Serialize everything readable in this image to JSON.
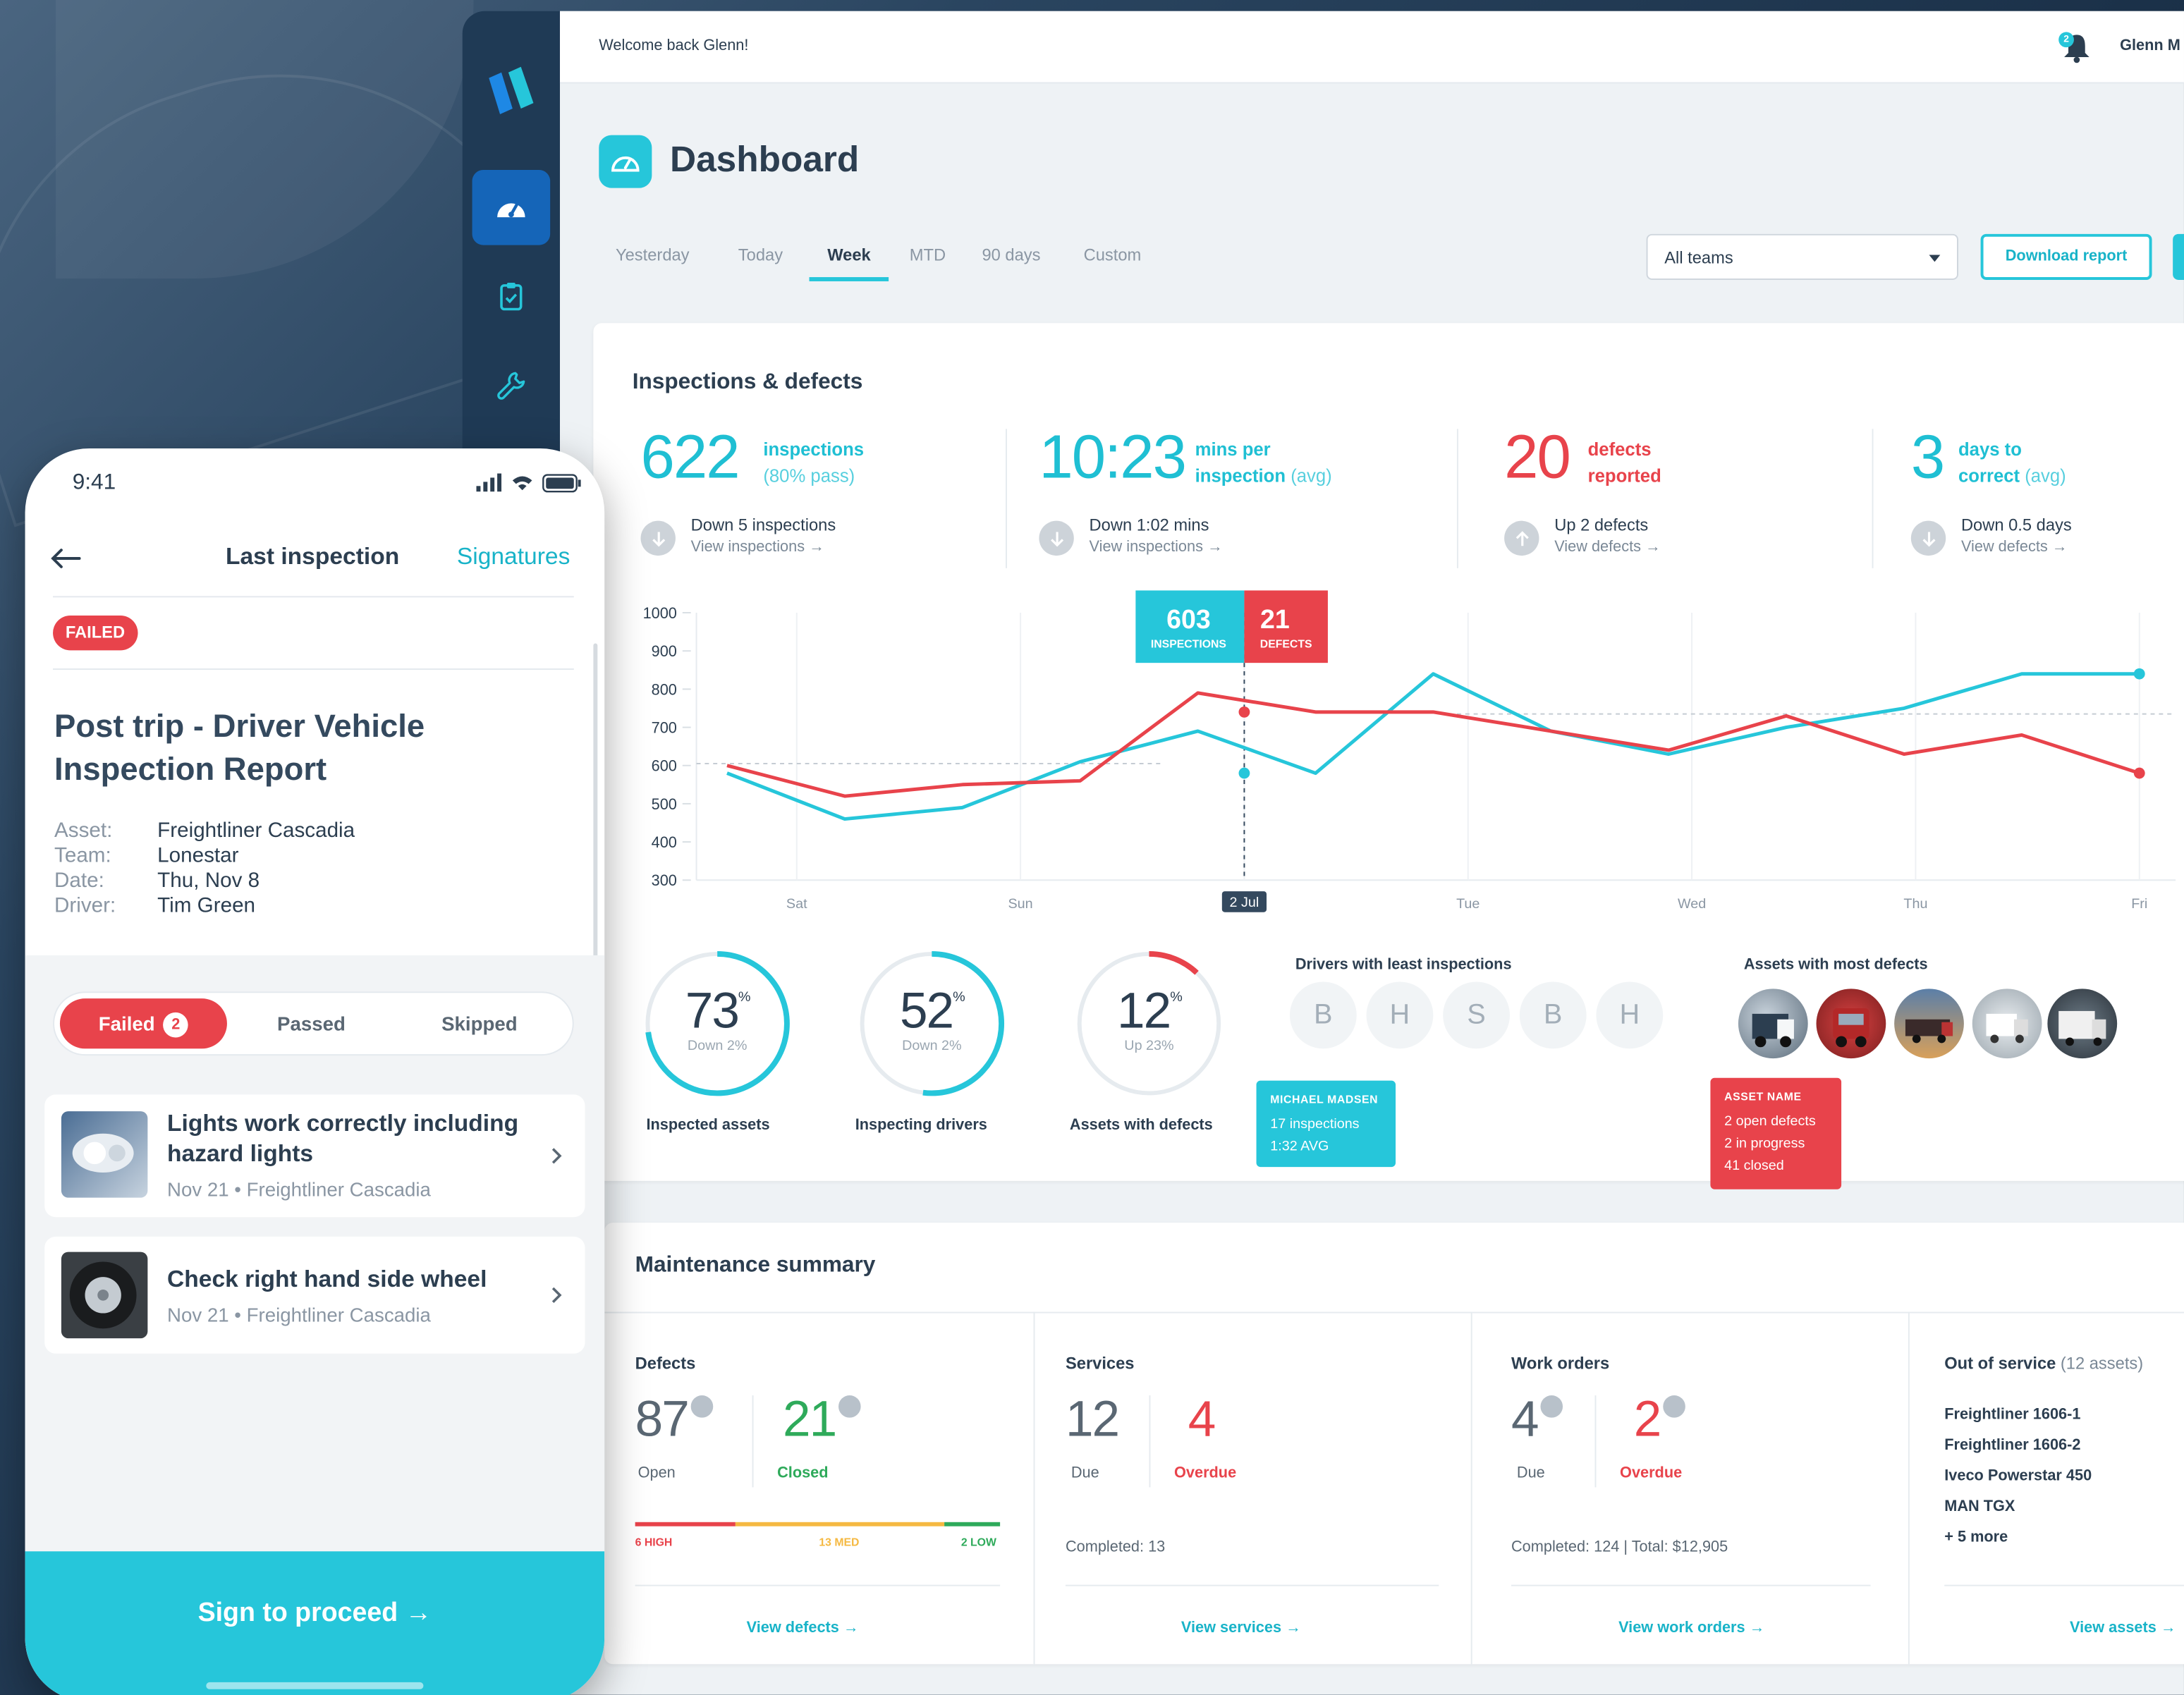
{
  "topbar": {
    "welcome": "Welcome back Glenn!",
    "notif_count": "2",
    "user": "Glenn M"
  },
  "page": {
    "title": "Dashboard"
  },
  "tabs": [
    "Yesterday",
    "Today",
    "Week",
    "MTD",
    "90 days",
    "Custom"
  ],
  "active_tab": "Week",
  "filter": {
    "team": "All teams",
    "download": "Download report"
  },
  "inspections": {
    "title": "Inspections & defects",
    "stats": [
      {
        "value": "622",
        "label1": "inspections",
        "label2": "(80% pass)",
        "line1": "Down 5 inspections",
        "line2": "View inspections →"
      },
      {
        "value": "10:23",
        "label1": "mins per",
        "label2a": "inspection",
        "label2b": "(avg)",
        "line1": "Down 1:02 mins",
        "line2": "View inspections →"
      },
      {
        "value": "20",
        "label1": "defects",
        "label2": "reported",
        "line1": "Up 2 defects",
        "line2": "View defects →"
      },
      {
        "value": "3",
        "label1": "days to",
        "label2a": "correct",
        "label2b": "(avg)",
        "line1": "Down 0.5 days",
        "line2": "View defects →"
      }
    ]
  },
  "chart_data": {
    "type": "line",
    "x": [
      "Sat",
      "Sun",
      "2 Jul",
      "Tue",
      "Wed",
      "Thu",
      "Fri"
    ],
    "x_positions_note_excluded": null,
    "y_ticks": [
      "1000",
      "900",
      "800",
      "700",
      "600",
      "500",
      "400",
      "300"
    ],
    "ylim": [
      300,
      1000
    ],
    "series": [
      {
        "name": "Inspections",
        "color": "#26c6da",
        "values": [
          580,
          460,
          490,
          610,
          690,
          580,
          840,
          690,
          630,
          700,
          750,
          840,
          840
        ]
      },
      {
        "name": "Defects",
        "color": "#e8434b",
        "values": [
          600,
          520,
          550,
          560,
          790,
          740,
          740,
          690,
          640,
          730,
          630,
          680,
          580
        ]
      }
    ],
    "tooltip": {
      "inspections_value": "603",
      "inspections_label": "INSPECTIONS",
      "defects_value": "21",
      "defects_label": "DEFECTS",
      "x_label": "2 Jul"
    }
  },
  "rings": [
    {
      "value": "73",
      "sub": "Down 2%",
      "label": "Inspected assets",
      "pct": 73,
      "color": "#26c6da"
    },
    {
      "value": "52",
      "sub": "Down 2%",
      "label": "Inspecting drivers",
      "pct": 52,
      "color": "#26c6da"
    },
    {
      "value": "12",
      "sub": "Up 23%",
      "label": "Assets with defects",
      "pct": 12,
      "color": "#e8434b"
    }
  ],
  "drivers": {
    "title": "Drivers with least inspections",
    "initials": [
      "B",
      "H",
      "S",
      "B",
      "H"
    ],
    "tooltip": {
      "name": "MICHAEL MADSEN",
      "l1": "17 inspections",
      "l2": "1:32 AVG"
    }
  },
  "assets": {
    "title": "Assets with most defects",
    "tooltip": {
      "name": "ASSET NAME",
      "l1": "2 open defects",
      "l2": "2 in progress",
      "l3": "41 closed"
    }
  },
  "maintenance": {
    "title": "Maintenance summary",
    "defects": {
      "title": "Defects",
      "open": "87",
      "open_label": "Open",
      "closed": "21",
      "closed_label": "Closed",
      "high": "6 HIGH",
      "med": "13 MED",
      "low": "2 LOW",
      "link": "View defects →"
    },
    "services": {
      "title": "Services",
      "due": "12",
      "due_label": "Due",
      "overdue": "4",
      "overdue_label": "Overdue",
      "completed": "Completed:  13",
      "link": "View services →"
    },
    "work_orders": {
      "title": "Work orders",
      "due": "4",
      "due_label": "Due",
      "overdue": "2",
      "overdue_label": "Overdue",
      "completed": "Completed: 124  |  Total: $12,905",
      "link": "View work orders →"
    },
    "out_of_service": {
      "title": "Out of service",
      "count": "(12 assets)",
      "items": [
        "Freightliner 1606-1",
        "Freightliner 1606-2",
        "Iveco Powerstar 450",
        "MAN TGX",
        "+ 5 more"
      ],
      "link": "View assets →"
    }
  },
  "phone": {
    "time": "9:41",
    "header": "Last inspection",
    "signatures": "Signatures",
    "status": "FAILED",
    "title": "Post trip - Driver Vehicle Inspection Report",
    "asset_k": "Asset:",
    "asset": "Freightliner Cascadia",
    "team_k": "Team:",
    "team": "Lonestar",
    "date_k": "Date:",
    "date": "Thu, Nov 8",
    "driver_k": "Driver:",
    "driver": "Tim Green",
    "seg_failed": "Failed",
    "seg_failed_count": "2",
    "seg_passed": "Passed",
    "seg_skipped": "Skipped",
    "items": [
      {
        "title": "Lights work correctly including hazard lights",
        "sub": "Nov 21 • Freightliner Cascadia"
      },
      {
        "title": "Check right hand side wheel",
        "sub": "Nov 21 • Freightliner Cascadia"
      }
    ],
    "cta": "Sign to proceed →"
  }
}
